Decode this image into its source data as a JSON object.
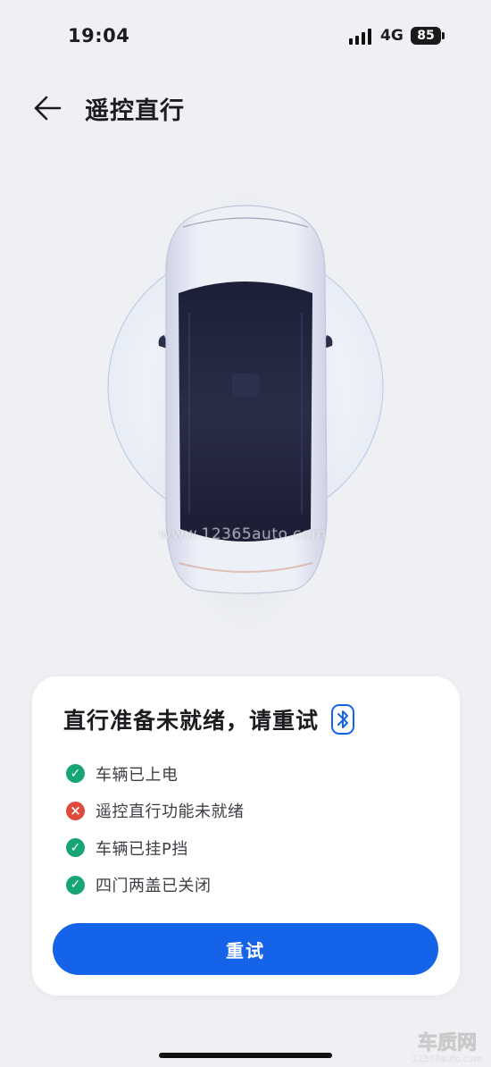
{
  "status_bar": {
    "time": "19:04",
    "network": "4G",
    "battery": "85"
  },
  "header": {
    "title": "遥控直行",
    "back_icon": "arrow-left-icon"
  },
  "watermark": "www.12365auto.com",
  "card": {
    "title": "直行准备未就绪，请重试",
    "title_icon": "bluetooth-icon",
    "checks": [
      {
        "label": "车辆已上电",
        "status": "ok"
      },
      {
        "label": "遥控直行功能未就绪",
        "status": "error"
      },
      {
        "label": "车辆已挂P挡",
        "status": "ok"
      },
      {
        "label": "四门两盖已关闭",
        "status": "ok"
      }
    ],
    "retry_label": "重试"
  },
  "colors": {
    "accent": "#1463e8",
    "ok": "#17a673",
    "error": "#e04a3a",
    "background": "#eef0f4"
  },
  "logo": {
    "name": "车质网",
    "url_text": "12365auto.com"
  }
}
